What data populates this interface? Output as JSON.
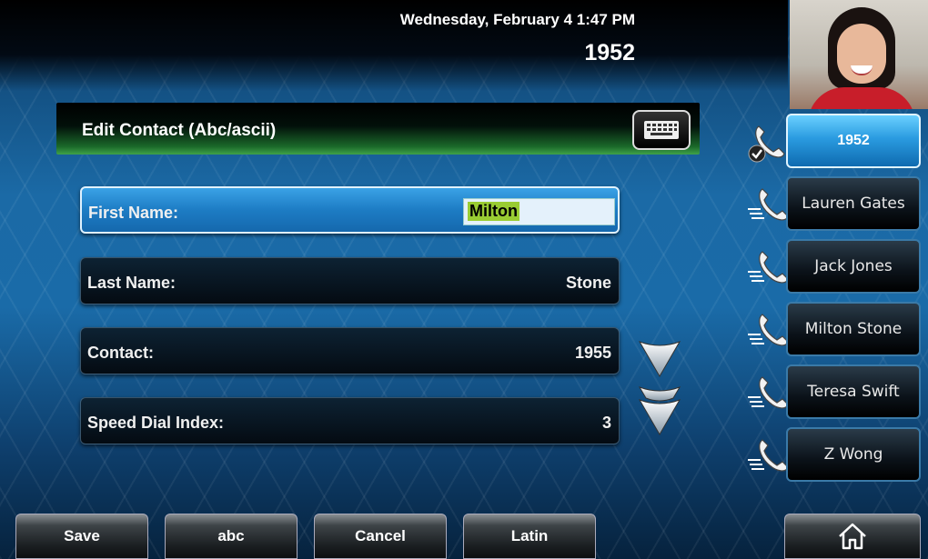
{
  "status_bar": {
    "datetime": "Wednesday, February 4  1:47 PM",
    "extension": "1952"
  },
  "contact_photo": {
    "icon": "caller-photo"
  },
  "header": {
    "title": "Edit Contact (Abc/ascii)",
    "keyboard_icon": "keyboard-icon"
  },
  "fields": [
    {
      "label": "First Name:",
      "value": "Milton"
    },
    {
      "label": "Last Name:",
      "value": "Stone"
    },
    {
      "label": "Contact:",
      "value": "1955"
    },
    {
      "label": "Speed Dial Index:",
      "value": "3"
    }
  ],
  "lines": [
    {
      "label": "1952",
      "icon": "phone-registered-icon"
    },
    {
      "label": "Lauren Gates",
      "icon": "speed-dial-phone-icon"
    },
    {
      "label": "Jack Jones",
      "icon": "speed-dial-phone-icon"
    },
    {
      "label": "Milton Stone",
      "icon": "speed-dial-phone-icon"
    },
    {
      "label": "Teresa Swift",
      "icon": "speed-dial-phone-icon"
    },
    {
      "label": "Z Wong",
      "icon": "speed-dial-phone-icon"
    }
  ],
  "softkeys": [
    "Save",
    "abc",
    "Cancel",
    "Latin"
  ],
  "home_icon": "home-icon",
  "colors": {
    "active_blue": "#2a9be0",
    "highlight_green": "#99cc33",
    "title_green": "#3fa24a"
  }
}
